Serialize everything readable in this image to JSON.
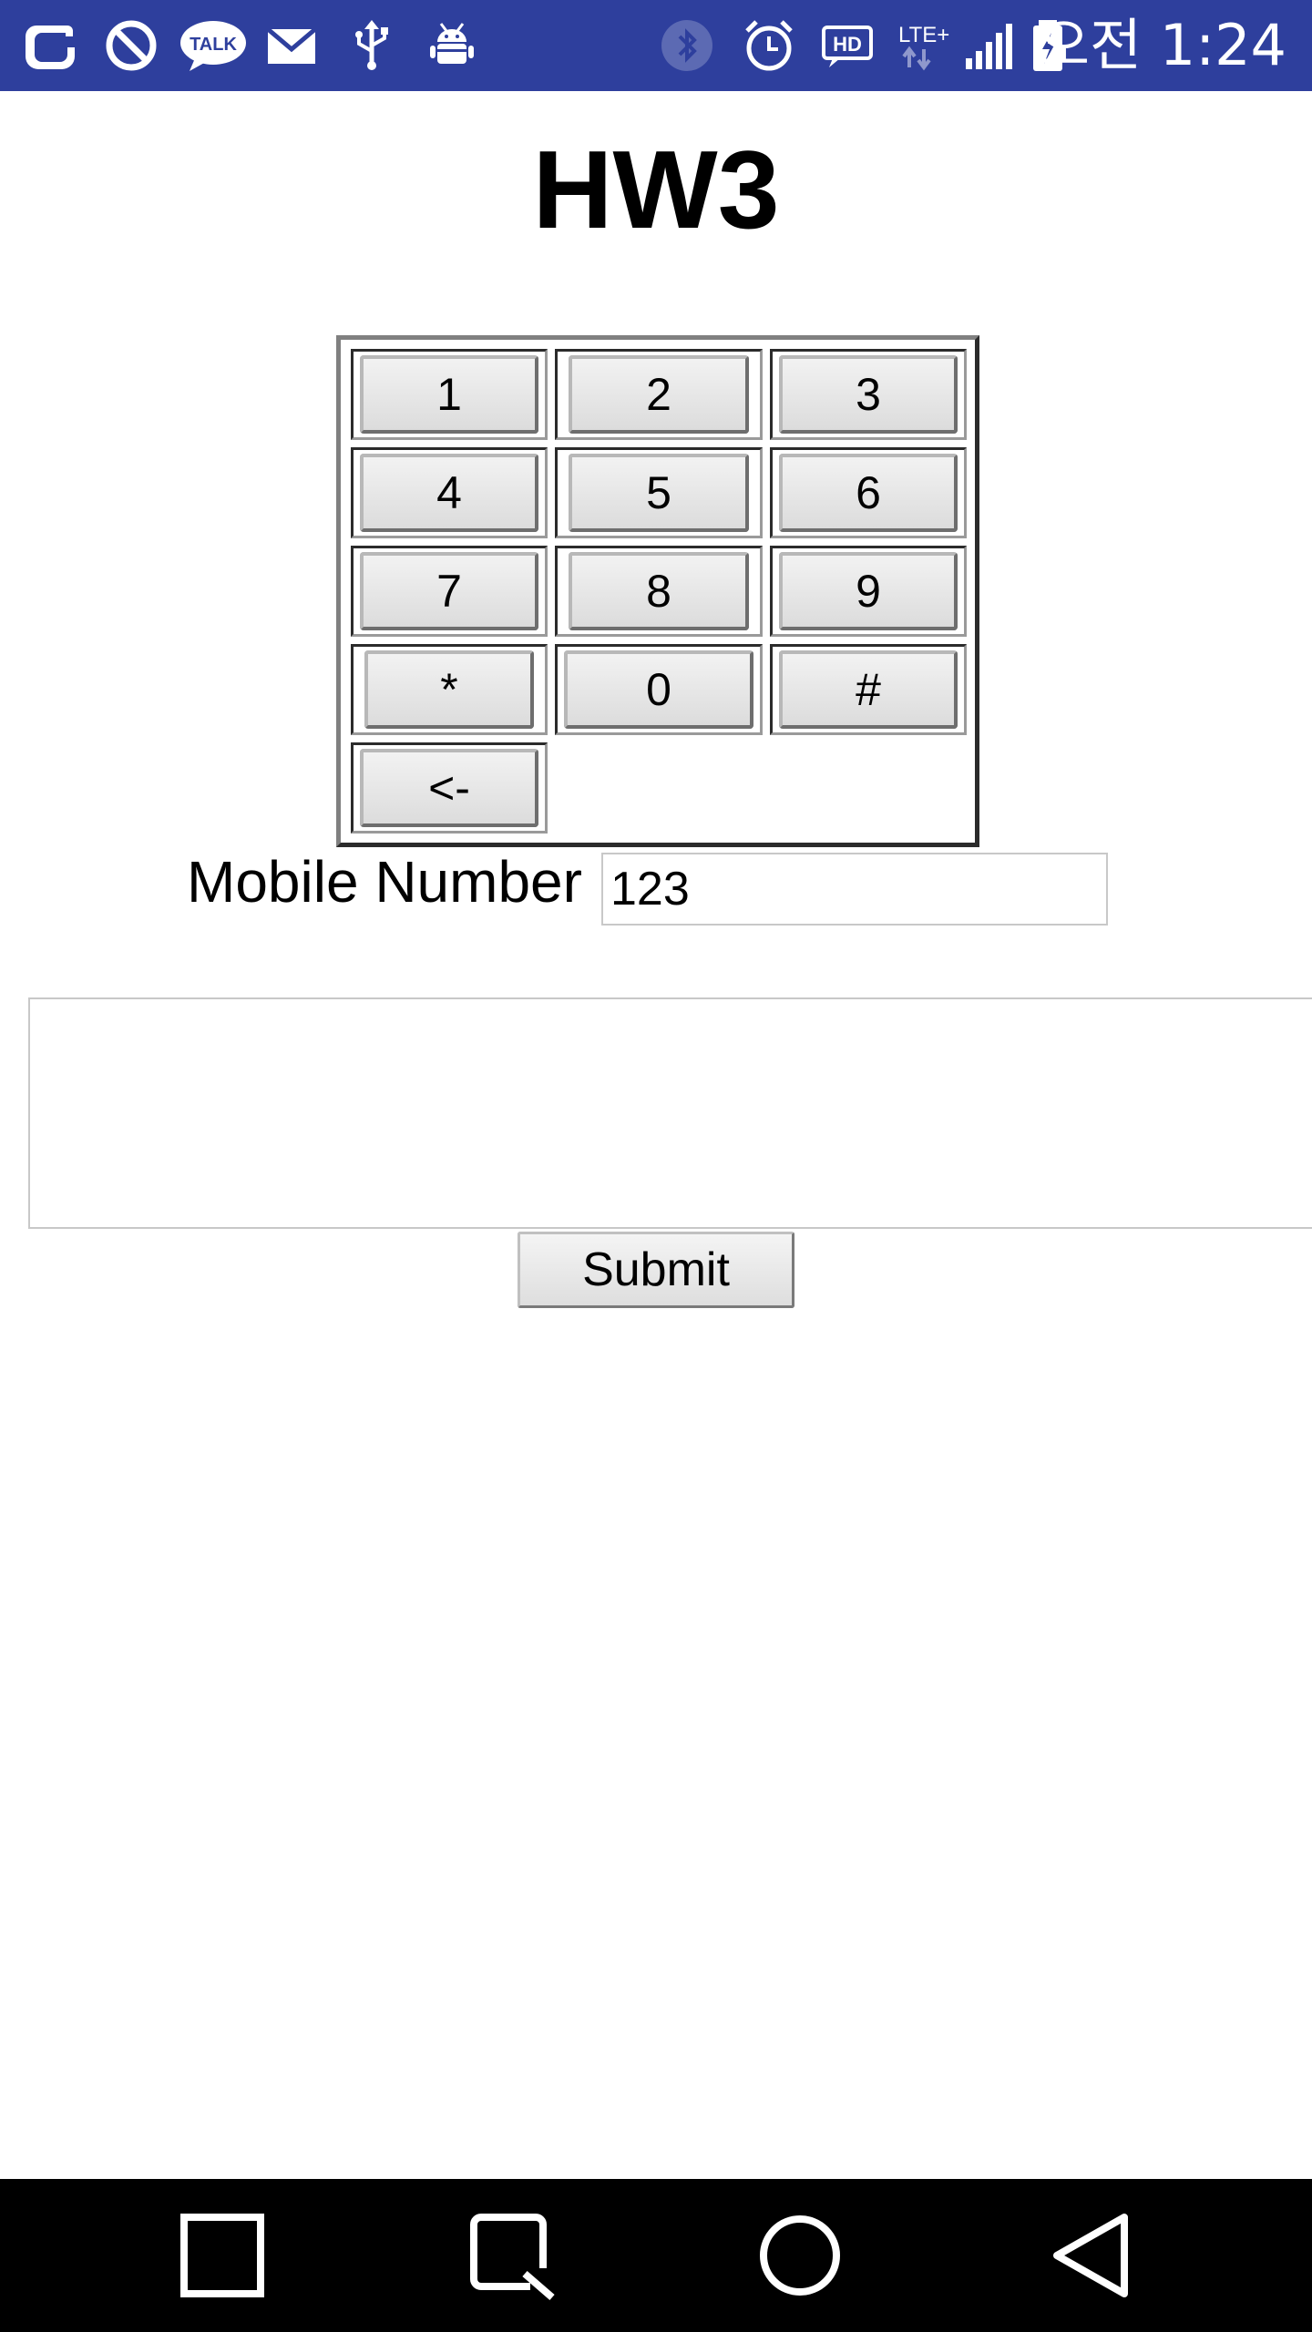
{
  "status_bar": {
    "time": "오전 1:24",
    "left_icons": [
      "opera-icon",
      "do-not-disturb-icon",
      "talk-icon",
      "mail-icon",
      "usb-icon",
      "android-debug-icon"
    ],
    "talk_badge_text": "TALK",
    "right_icons": [
      "bluetooth-icon",
      "alarm-icon",
      "hd-voice-icon",
      "lte-icon",
      "signal-icon",
      "battery-charging-icon"
    ],
    "hd_label": "HD",
    "lte_label": "LTE+"
  },
  "page": {
    "title": "HW3"
  },
  "keypad": {
    "keys": [
      "1",
      "2",
      "3",
      "4",
      "5",
      "6",
      "7",
      "8",
      "9",
      "*",
      "0",
      "#"
    ],
    "backspace_label": "<-"
  },
  "form": {
    "mobile_label": "Mobile Number",
    "mobile_value": "123",
    "message_value": "",
    "submit_label": "Submit"
  },
  "nav_bar": {
    "buttons": [
      "recent-apps-icon",
      "capture-icon",
      "home-icon",
      "back-icon"
    ]
  }
}
